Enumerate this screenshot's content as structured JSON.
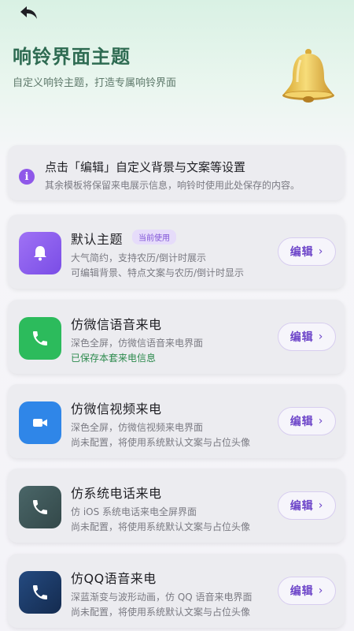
{
  "header": {
    "title": "响铃界面主题",
    "subtitle": "自定义响铃主题，打造专属响铃界面"
  },
  "info": {
    "title": "点击「编辑」自定义背景与文案等设置",
    "desc": "其余模板将保留来电展示信息，响铃时使用此处保存的内容。"
  },
  "edit_label": "编辑",
  "themes": [
    {
      "name": "默认主题",
      "badge": "当前使用",
      "line1": "大气简约，支持农历/倒计时展示",
      "line2": "可编辑背景、特点文案与农历/倒计时显示",
      "icon": "bell-icon",
      "color": "#8a5cf0"
    },
    {
      "name": "仿微信语音来电",
      "line1": "深色全屏，仿微信语音来电界面",
      "line2": "已保存本套来电信息",
      "icon": "phone-icon",
      "color": "#2cbb5c"
    },
    {
      "name": "仿微信视频来电",
      "line1": "深色全屏，仿微信视频来电界面",
      "line2": "尚未配置，将使用系统默认文案与占位头像",
      "icon": "video-icon",
      "color": "#2f86e8"
    },
    {
      "name": "仿系统电话来电",
      "line1": "仿 iOS 系统电话来电全屏界面",
      "line2": "尚未配置，将使用系统默认文案与占位头像",
      "icon": "phone-icon",
      "color": "#3f5a5c"
    },
    {
      "name": "仿QQ语音来电",
      "line1": "深蓝渐变与波形动画，仿 QQ 语音来电界面",
      "line2": "尚未配置，将使用系统默认文案与占位头像",
      "icon": "phone-icon",
      "color": "#1b3a66"
    }
  ]
}
